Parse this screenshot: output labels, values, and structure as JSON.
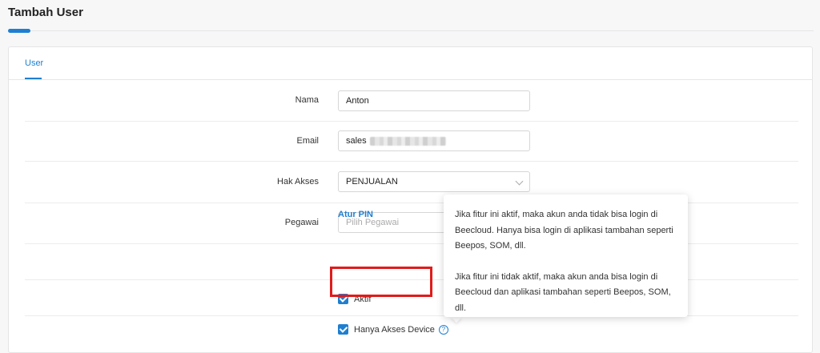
{
  "page": {
    "title": "Tambah User"
  },
  "tabs": [
    {
      "label": "User"
    }
  ],
  "form": {
    "nama": {
      "label": "Nama",
      "value": "Anton"
    },
    "email": {
      "label": "Email",
      "value": "sales"
    },
    "hak_akses": {
      "label": "Hak Akses",
      "value": "PENJUALAN"
    },
    "pegawai": {
      "label": "Pegawai",
      "placeholder": "Pilih Pegawai"
    },
    "atur_pin": "Atur PIN",
    "aktif": {
      "label": "Aktif",
      "checked": true
    },
    "hanya_akses_device": {
      "label": "Hanya Akses Device",
      "checked": true
    }
  },
  "tooltip": {
    "para1": "Jika fitur ini aktif, maka akun anda tidak bisa login di Beecloud. Hanya bisa login di aplikasi tambahan seperti Beepos, SOM, dll.",
    "para2": "Jika fitur ini tidak aktif, maka akun anda bisa login di Beecloud dan aplikasi tambahan seperti Beepos, SOM, dll."
  },
  "colors": {
    "accent": "#1e7fd1",
    "highlight": "#e01b1b"
  },
  "icons": {
    "help": "question-circle-icon",
    "dropdown": "chevron-down-icon",
    "checkbox": "checkmark-icon"
  }
}
